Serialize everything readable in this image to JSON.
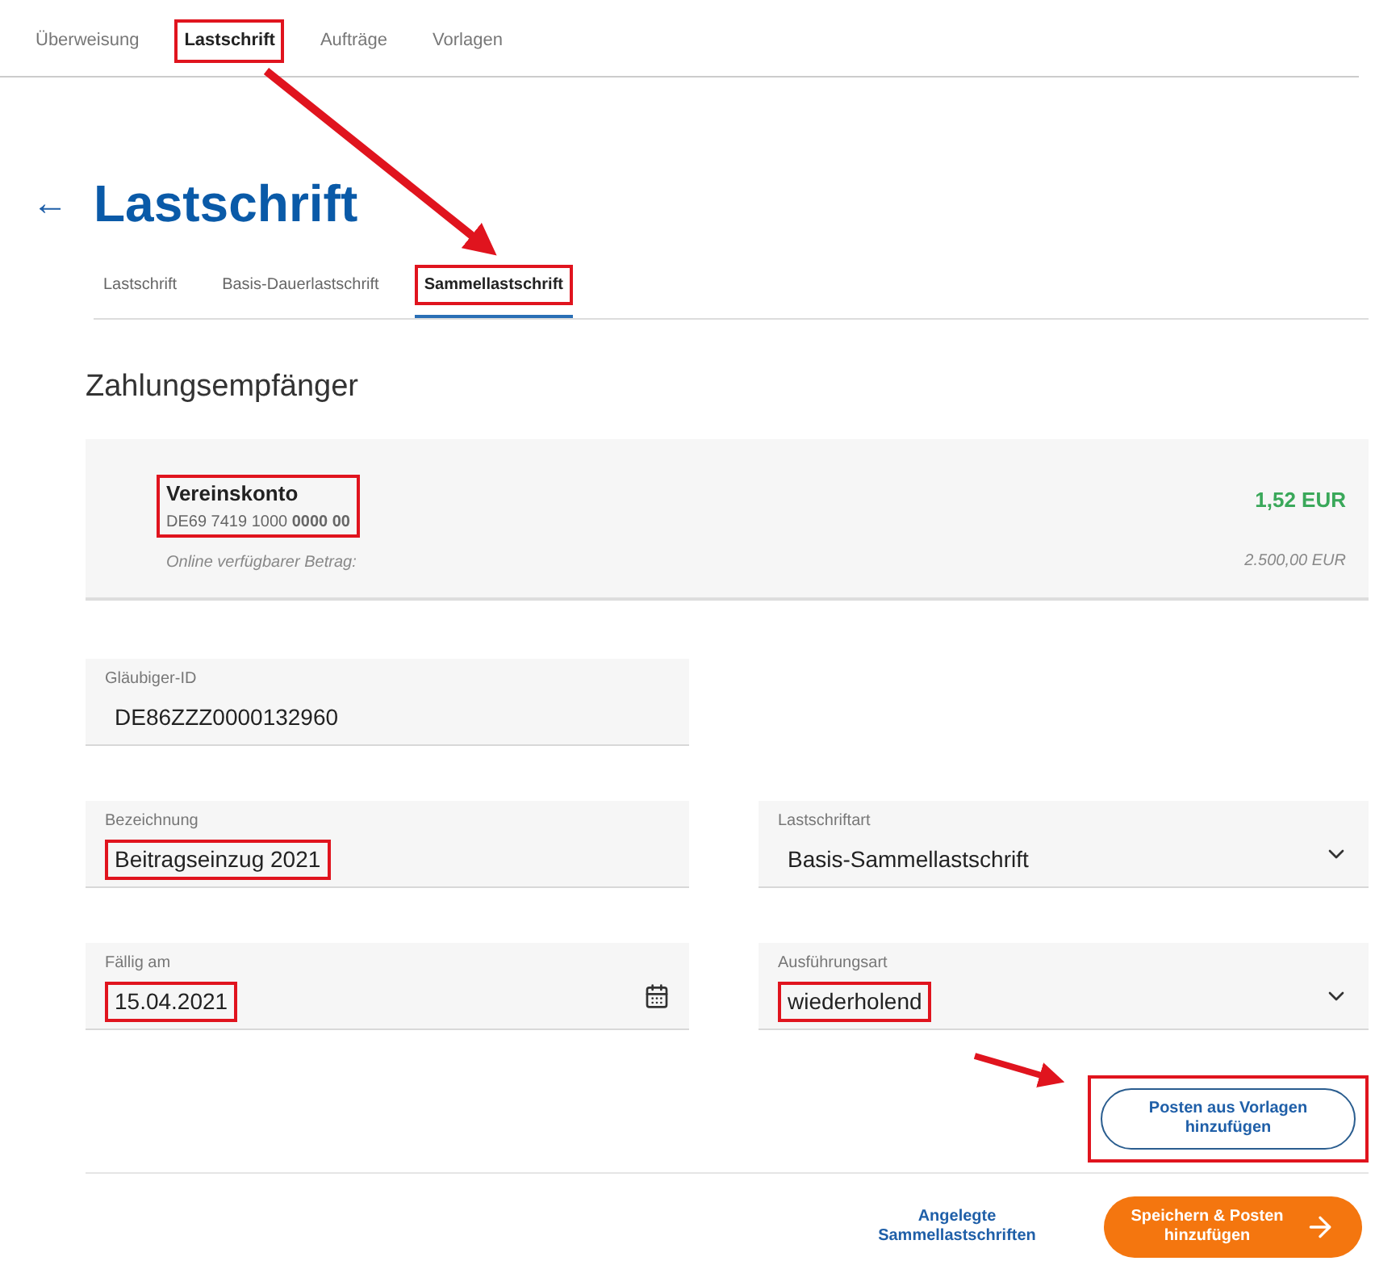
{
  "top_tabs": [
    {
      "label": "Überweisung",
      "selected": false,
      "highlighted": false
    },
    {
      "label": "Lastschrift",
      "selected": true,
      "highlighted": true
    },
    {
      "label": "Aufträge",
      "selected": false,
      "highlighted": false
    },
    {
      "label": "Vorlagen",
      "selected": false,
      "highlighted": false
    }
  ],
  "back_arrow": "←",
  "title": "Lastschrift",
  "sub_tabs": [
    {
      "label": "Lastschrift",
      "selected": false,
      "highlighted": false
    },
    {
      "label": "Basis-Dauerlastschrift",
      "selected": false,
      "highlighted": false
    },
    {
      "label": "Sammellastschrift",
      "selected": true,
      "highlighted": true
    }
  ],
  "section_title": "Zahlungsempfänger",
  "account": {
    "name": "Vereinskonto",
    "iban": "DE69 7419 1000 **0000 00**",
    "highlighted": true,
    "balance": "1,52 EUR",
    "available_label": "Online verfügbarer Betrag:",
    "available_amount": "2.500,00 EUR"
  },
  "fields": [
    {
      "kind": "text",
      "label": "Gläubiger-ID",
      "value": "DE86ZZZ0000132960",
      "highlighted": false
    },
    {
      "kind": "spacer"
    },
    {
      "kind": "text",
      "label": "Bezeichnung",
      "value": "Beitragseinzug 2021",
      "highlighted": true
    },
    {
      "kind": "select",
      "label": "Lastschriftart",
      "value": "Basis-Sammellastschrift",
      "highlighted": false
    },
    {
      "kind": "date",
      "label": "Fällig am",
      "value": "15.04.2021",
      "highlighted": true
    },
    {
      "kind": "select",
      "label": "Ausführungsart",
      "value": "wiederholend",
      "highlighted": true
    }
  ],
  "template_button": {
    "label": "Posten aus Vorlagen hinzufügen",
    "highlighted": true
  },
  "footer": {
    "link": "Angelegte Sammellastschriften",
    "primary_button": "Speichern & Posten hinzufügen"
  }
}
